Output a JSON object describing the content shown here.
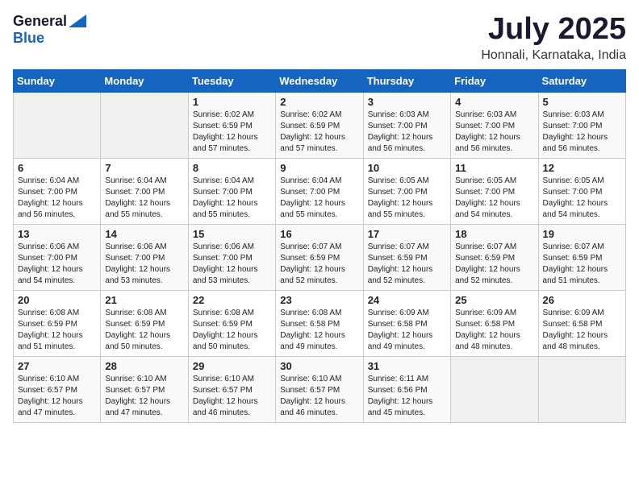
{
  "header": {
    "logo_general": "General",
    "logo_blue": "Blue",
    "title": "July 2025",
    "location": "Honnali, Karnataka, India"
  },
  "calendar": {
    "days_of_week": [
      "Sunday",
      "Monday",
      "Tuesday",
      "Wednesday",
      "Thursday",
      "Friday",
      "Saturday"
    ],
    "weeks": [
      [
        {
          "day": "",
          "info": ""
        },
        {
          "day": "",
          "info": ""
        },
        {
          "day": "1",
          "sunrise": "6:02 AM",
          "sunset": "6:59 PM",
          "daylight": "12 hours and 57 minutes."
        },
        {
          "day": "2",
          "sunrise": "6:02 AM",
          "sunset": "6:59 PM",
          "daylight": "12 hours and 57 minutes."
        },
        {
          "day": "3",
          "sunrise": "6:03 AM",
          "sunset": "7:00 PM",
          "daylight": "12 hours and 56 minutes."
        },
        {
          "day": "4",
          "sunrise": "6:03 AM",
          "sunset": "7:00 PM",
          "daylight": "12 hours and 56 minutes."
        },
        {
          "day": "5",
          "sunrise": "6:03 AM",
          "sunset": "7:00 PM",
          "daylight": "12 hours and 56 minutes."
        }
      ],
      [
        {
          "day": "6",
          "sunrise": "6:04 AM",
          "sunset": "7:00 PM",
          "daylight": "12 hours and 56 minutes."
        },
        {
          "day": "7",
          "sunrise": "6:04 AM",
          "sunset": "7:00 PM",
          "daylight": "12 hours and 55 minutes."
        },
        {
          "day": "8",
          "sunrise": "6:04 AM",
          "sunset": "7:00 PM",
          "daylight": "12 hours and 55 minutes."
        },
        {
          "day": "9",
          "sunrise": "6:04 AM",
          "sunset": "7:00 PM",
          "daylight": "12 hours and 55 minutes."
        },
        {
          "day": "10",
          "sunrise": "6:05 AM",
          "sunset": "7:00 PM",
          "daylight": "12 hours and 55 minutes."
        },
        {
          "day": "11",
          "sunrise": "6:05 AM",
          "sunset": "7:00 PM",
          "daylight": "12 hours and 54 minutes."
        },
        {
          "day": "12",
          "sunrise": "6:05 AM",
          "sunset": "7:00 PM",
          "daylight": "12 hours and 54 minutes."
        }
      ],
      [
        {
          "day": "13",
          "sunrise": "6:06 AM",
          "sunset": "7:00 PM",
          "daylight": "12 hours and 54 minutes."
        },
        {
          "day": "14",
          "sunrise": "6:06 AM",
          "sunset": "7:00 PM",
          "daylight": "12 hours and 53 minutes."
        },
        {
          "day": "15",
          "sunrise": "6:06 AM",
          "sunset": "7:00 PM",
          "daylight": "12 hours and 53 minutes."
        },
        {
          "day": "16",
          "sunrise": "6:07 AM",
          "sunset": "6:59 PM",
          "daylight": "12 hours and 52 minutes."
        },
        {
          "day": "17",
          "sunrise": "6:07 AM",
          "sunset": "6:59 PM",
          "daylight": "12 hours and 52 minutes."
        },
        {
          "day": "18",
          "sunrise": "6:07 AM",
          "sunset": "6:59 PM",
          "daylight": "12 hours and 52 minutes."
        },
        {
          "day": "19",
          "sunrise": "6:07 AM",
          "sunset": "6:59 PM",
          "daylight": "12 hours and 51 minutes."
        }
      ],
      [
        {
          "day": "20",
          "sunrise": "6:08 AM",
          "sunset": "6:59 PM",
          "daylight": "12 hours and 51 minutes."
        },
        {
          "day": "21",
          "sunrise": "6:08 AM",
          "sunset": "6:59 PM",
          "daylight": "12 hours and 50 minutes."
        },
        {
          "day": "22",
          "sunrise": "6:08 AM",
          "sunset": "6:59 PM",
          "daylight": "12 hours and 50 minutes."
        },
        {
          "day": "23",
          "sunrise": "6:08 AM",
          "sunset": "6:58 PM",
          "daylight": "12 hours and 49 minutes."
        },
        {
          "day": "24",
          "sunrise": "6:09 AM",
          "sunset": "6:58 PM",
          "daylight": "12 hours and 49 minutes."
        },
        {
          "day": "25",
          "sunrise": "6:09 AM",
          "sunset": "6:58 PM",
          "daylight": "12 hours and 48 minutes."
        },
        {
          "day": "26",
          "sunrise": "6:09 AM",
          "sunset": "6:58 PM",
          "daylight": "12 hours and 48 minutes."
        }
      ],
      [
        {
          "day": "27",
          "sunrise": "6:10 AM",
          "sunset": "6:57 PM",
          "daylight": "12 hours and 47 minutes."
        },
        {
          "day": "28",
          "sunrise": "6:10 AM",
          "sunset": "6:57 PM",
          "daylight": "12 hours and 47 minutes."
        },
        {
          "day": "29",
          "sunrise": "6:10 AM",
          "sunset": "6:57 PM",
          "daylight": "12 hours and 46 minutes."
        },
        {
          "day": "30",
          "sunrise": "6:10 AM",
          "sunset": "6:57 PM",
          "daylight": "12 hours and 46 minutes."
        },
        {
          "day": "31",
          "sunrise": "6:11 AM",
          "sunset": "6:56 PM",
          "daylight": "12 hours and 45 minutes."
        },
        {
          "day": "",
          "info": ""
        },
        {
          "day": "",
          "info": ""
        }
      ]
    ]
  }
}
